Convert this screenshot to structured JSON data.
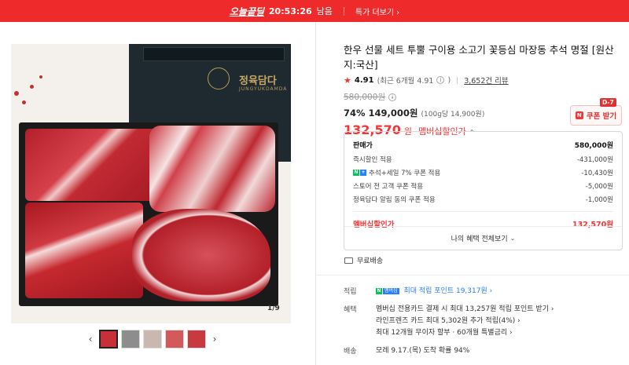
{
  "topbar": {
    "deal_label": "오늘끝딜",
    "timer": "20:53:26",
    "remain": "남음",
    "more": "특가 더보기 ›"
  },
  "gallery": {
    "logo_text": "정육담다",
    "logo_sub": "JUNGYUKDAMDA",
    "counter": "1/9",
    "prev_icon": "‹",
    "next_icon": "›"
  },
  "product": {
    "title": "한우 선물 세트 투뿔 구이용 소고기 꽃등심 마장동 추석 명절 [원산지:국산]",
    "rating": "4.91",
    "rating_detail": "(최근 6개월 4.91",
    "review_count": "3,652건 리뷰",
    "original_price": "580,000원",
    "sale_rate": "74%",
    "sale_price": "149,000원",
    "unit_price": "(100g당 14,900원)",
    "member_price": "132,570",
    "member_won": "원",
    "member_label": "멤버십할인가"
  },
  "coupon": {
    "tag": "D-7",
    "n": "N",
    "label": "쿠폰 받기"
  },
  "breakdown": {
    "rows": [
      {
        "label": "판매가",
        "value": "580,000원"
      },
      {
        "label": "즉시할인 적용",
        "value": "-431,000원"
      },
      {
        "label": "추석+세일 7% 쿠폰 적용",
        "value": "-10,430원"
      },
      {
        "label": "스토어 전 고객 쿠폰 적용",
        "value": "-5,000원"
      },
      {
        "label": "정육담다 알림 동의 쿠폰 적용",
        "value": "-1,000원"
      }
    ],
    "total_label": "멤버십할인가",
    "total_value": "132,570원",
    "all_benefits": "나의 혜택 전체보기",
    "np_n": "N",
    "np_p": "+"
  },
  "shipping": {
    "label": "무료배송"
  },
  "details": {
    "point_key": "적립",
    "point_badge_n": "N",
    "point_badge_t": "멤버십",
    "point_value": "최대 적립 포인트 19,317원 ›",
    "benefit_key": "혜택",
    "benefit_lines": [
      "멤버십 전용카드 결제 시 최대 13,257원 적립 포인트 받기 ›",
      "라인프렌즈 카드 최대 5,302원 추가 적립(4%) ›",
      "최대 12개월 무이자 할부 · 60개월 특별금리 ›"
    ],
    "delivery_key": "배송",
    "delivery_value": "모레 9.17.(목) 도착 확률 94%"
  }
}
